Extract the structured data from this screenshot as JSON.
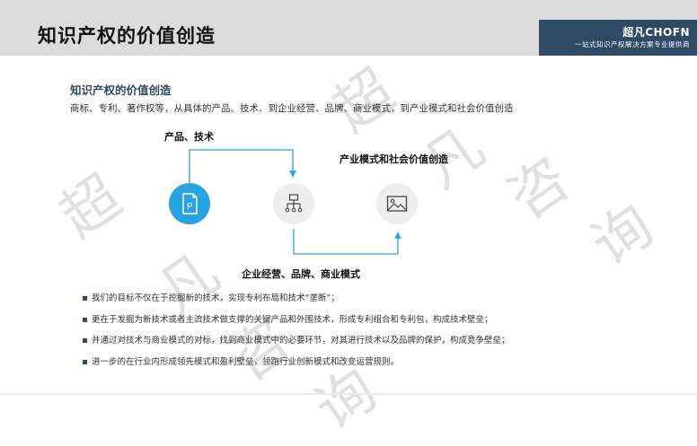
{
  "header": {
    "title": "知识产权的价值创造",
    "brand_logo": "超凡CHOFN",
    "brand_tagline": "一站式知识产权解决方案专业提供商"
  },
  "section": {
    "title": "知识产权的价值创造",
    "description": "商标、专利、著作权等，从具体的产品、技术、到企业经营、品牌、商业模式，到产业模式和社会价值创造"
  },
  "diagram": {
    "label_product_tech": "产品、技术",
    "label_business": "企业经营、品牌、商业模式",
    "label_industry": "产业模式和社会价值创造",
    "accent": "#29a3e0"
  },
  "bullets": [
    "我们的目标不仅在于挖掘新的技术，实现专利布局和技术“垄断”；",
    "更在于发掘为新技术或者主流技术做支撑的关键产品和外围技术，形成专利组合和专利包，构成技术壁垒；",
    "并通过对技术与商业模式的对标，找到商业模式中的必要环节，对其进行技术以及品牌的保护，构成竞争壁垒；",
    "进一步的在行业内形成领先模式和盈利壁垒，领跑行业创新模式和改变运营规则。"
  ],
  "watermark": [
    "超",
    "凡",
    "咨",
    "询",
    "超",
    "凡",
    "咨",
    "询"
  ]
}
